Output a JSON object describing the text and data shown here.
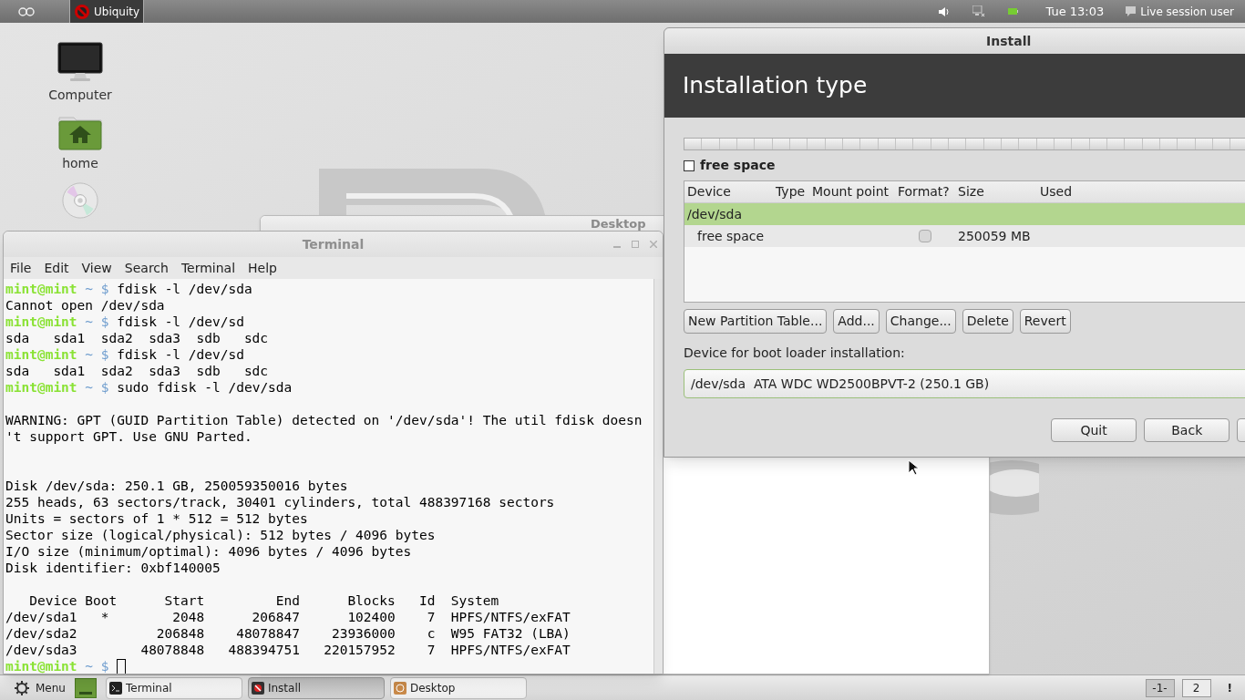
{
  "top_panel": {
    "apps": [
      {
        "label": "Ubiquity",
        "selected": true
      }
    ],
    "clock": "Tue 13:03",
    "user": "Live session user"
  },
  "desktop_icons": [
    {
      "kind": "computer",
      "label": "Computer"
    },
    {
      "kind": "home",
      "label": "home"
    },
    {
      "kind": "disc"
    }
  ],
  "desktop_window": {
    "title": "Desktop"
  },
  "terminal": {
    "title": "Terminal",
    "menu": [
      "File",
      "Edit",
      "View",
      "Search",
      "Terminal",
      "Help"
    ],
    "lines": [
      {
        "kind": "prompt",
        "user": "mint@mint",
        "path": "~",
        "symbol": "$",
        "command": "fdisk -l /dev/sda"
      },
      {
        "kind": "output",
        "text": "Cannot open /dev/sda"
      },
      {
        "kind": "prompt",
        "user": "mint@mint",
        "path": "~",
        "symbol": "$",
        "command": "fdisk -l /dev/sd"
      },
      {
        "kind": "output",
        "text": "sda   sda1  sda2  sda3  sdb   sdc"
      },
      {
        "kind": "prompt",
        "user": "mint@mint",
        "path": "~",
        "symbol": "$",
        "command": "fdisk -l /dev/sd"
      },
      {
        "kind": "output",
        "text": "sda   sda1  sda2  sda3  sdb   sdc"
      },
      {
        "kind": "prompt",
        "user": "mint@mint",
        "path": "~",
        "symbol": "$",
        "command": "sudo fdisk -l /dev/sda"
      },
      {
        "kind": "blank"
      },
      {
        "kind": "output",
        "text": "WARNING: GPT (GUID Partition Table) detected on '/dev/sda'! The util fdisk doesn"
      },
      {
        "kind": "output",
        "text": "'t support GPT. Use GNU Parted."
      },
      {
        "kind": "blank"
      },
      {
        "kind": "blank"
      },
      {
        "kind": "output",
        "text": "Disk /dev/sda: 250.1 GB, 250059350016 bytes"
      },
      {
        "kind": "output",
        "text": "255 heads, 63 sectors/track, 30401 cylinders, total 488397168 sectors"
      },
      {
        "kind": "output",
        "text": "Units = sectors of 1 * 512 = 512 bytes"
      },
      {
        "kind": "output",
        "text": "Sector size (logical/physical): 512 bytes / 4096 bytes"
      },
      {
        "kind": "output",
        "text": "I/O size (minimum/optimal): 4096 bytes / 4096 bytes"
      },
      {
        "kind": "output",
        "text": "Disk identifier: 0xbf140005"
      },
      {
        "kind": "blank"
      },
      {
        "kind": "output",
        "text": "   Device Boot      Start         End      Blocks   Id  System"
      },
      {
        "kind": "output",
        "text": "/dev/sda1   *        2048      206847      102400    7  HPFS/NTFS/exFAT"
      },
      {
        "kind": "output",
        "text": "/dev/sda2          206848    48078847    23936000    c  W95 FAT32 (LBA)"
      },
      {
        "kind": "output",
        "text": "/dev/sda3        48078848   488394751   220157952    7  HPFS/NTFS/exFAT"
      },
      {
        "kind": "input",
        "user": "mint@mint",
        "path": "~",
        "symbol": "$"
      }
    ]
  },
  "install": {
    "title": "Install",
    "heading": "Installation type",
    "legend": {
      "label": "free space"
    },
    "columns": [
      "Device",
      "Type",
      "Mount point",
      "Format?",
      "Size",
      "Used"
    ],
    "rows": [
      {
        "device": "/dev/sda",
        "selected": true
      },
      {
        "device": "free space",
        "format": {
          "checked": false
        },
        "size": "250059 MB",
        "selected": false
      }
    ],
    "buttons": [
      "New Partition Table...",
      "Add...",
      "Change...",
      "Delete",
      "Revert"
    ],
    "boot_label": "Device for boot loader installation:",
    "boot_device": "/dev/sda  ATA WDC WD2500BPVT-2 (250.1 GB)",
    "nav_buttons": [
      "Quit",
      "Back"
    ]
  },
  "taskbar": {
    "menu": "Menu",
    "windows": [
      {
        "kind": "terminal",
        "label": "Terminal",
        "selected": false
      },
      {
        "kind": "install",
        "label": "Install",
        "selected": true
      },
      {
        "kind": "desktop",
        "label": "Desktop",
        "selected": false
      }
    ],
    "workspaces": [
      {
        "label": "-1-",
        "selected": true
      },
      {
        "label": "2",
        "selected": false
      }
    ],
    "notice": "!"
  }
}
